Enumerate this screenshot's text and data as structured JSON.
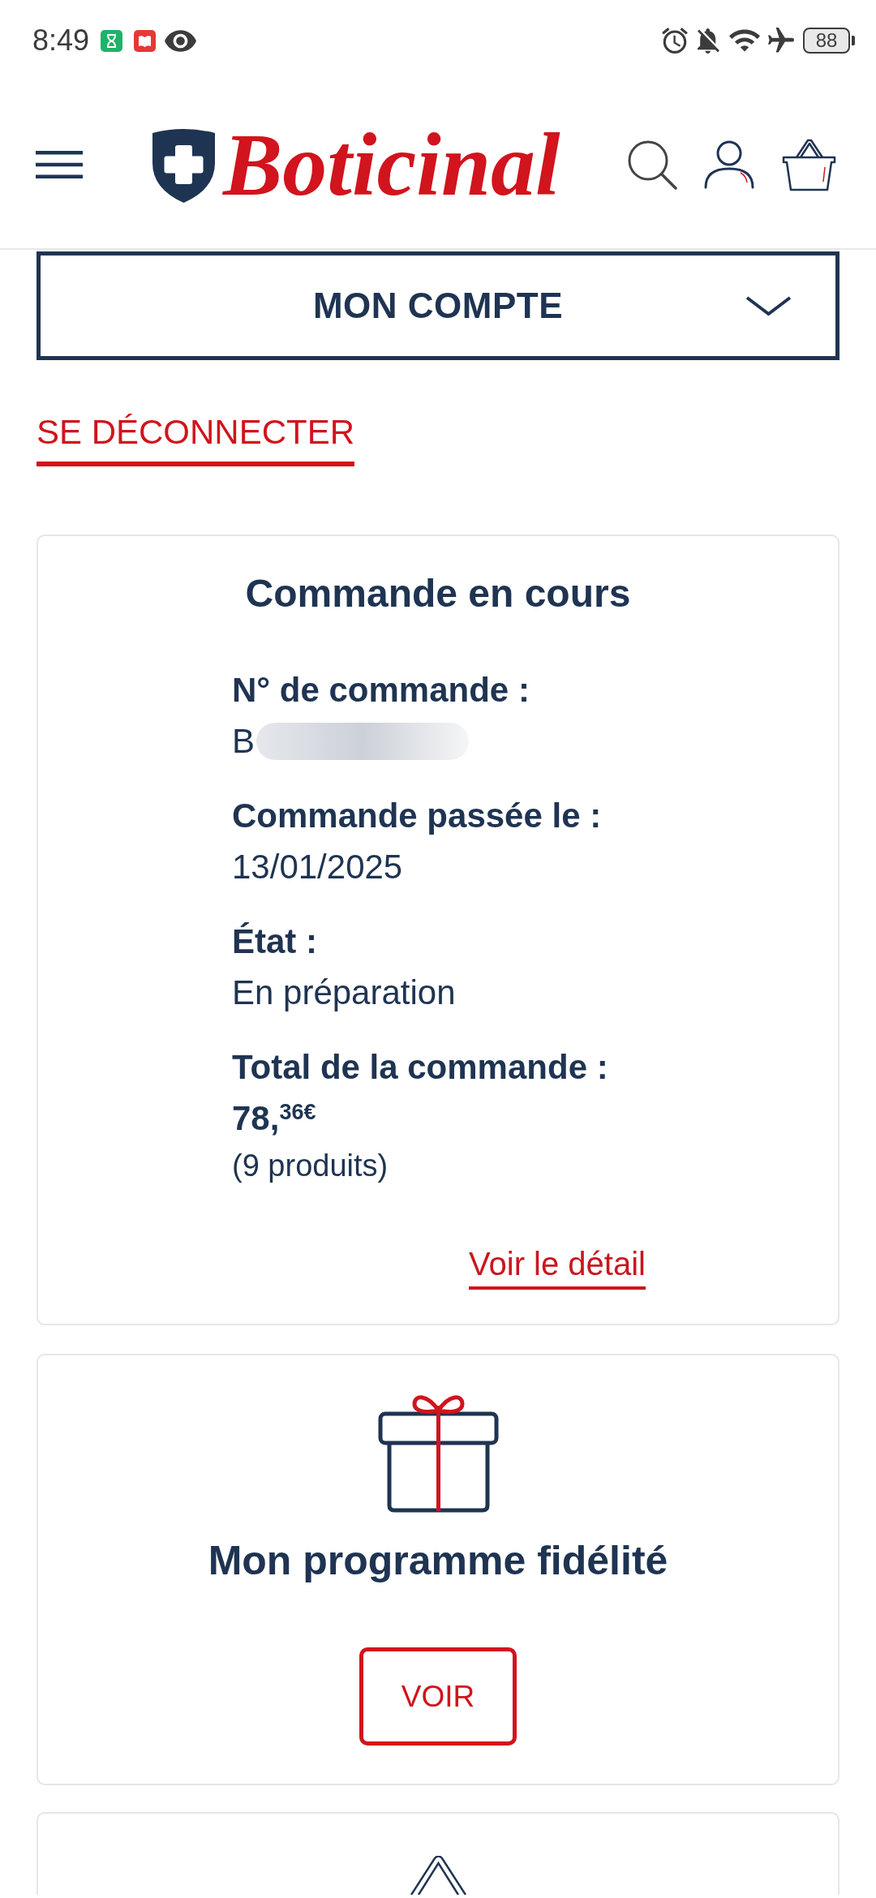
{
  "status_bar": {
    "time": "8:49",
    "battery": "88"
  },
  "header": {
    "logo": "Boticinal"
  },
  "account_menu": {
    "label": "MON COMPTE",
    "expanded": false
  },
  "logout_link": {
    "label": "SE DÉCONNECTER"
  },
  "order_card": {
    "title": "Commande en cours",
    "fields": [
      {
        "kind": "text",
        "label": "N° de commande :",
        "value": "B",
        "redacted": true
      },
      {
        "kind": "text",
        "label": "Commande passée le :",
        "value": "13/01/2025",
        "redacted": false
      },
      {
        "kind": "text",
        "label": "État :",
        "value": "En préparation",
        "redacted": false
      },
      {
        "kind": "price",
        "label": "Total de la commande :",
        "value": "78,$^{36€}$",
        "note": "(9 produits)"
      }
    ],
    "detail_link": "Voir le détail"
  },
  "loyalty_card": {
    "title": "Mon programme fidélité",
    "button": "VOIR"
  }
}
